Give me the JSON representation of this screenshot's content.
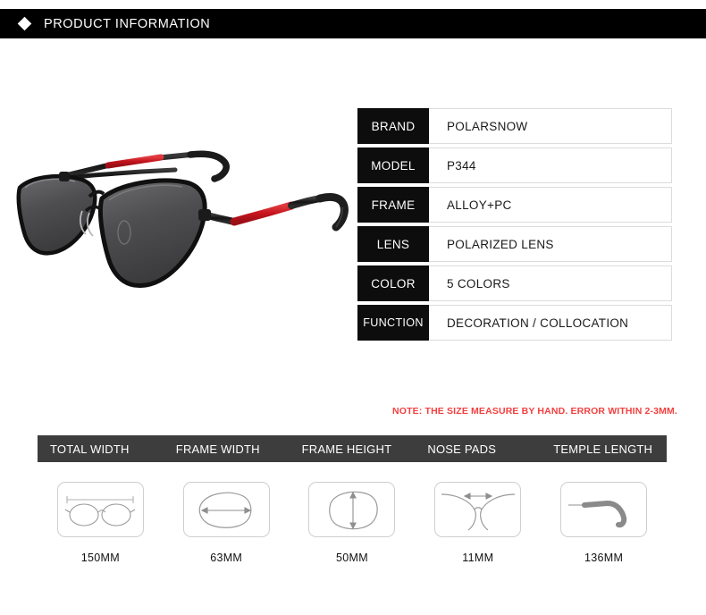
{
  "header": {
    "icon": "diamond-bullet-icon",
    "title": "PRODUCT INFORMATION"
  },
  "product_image": {
    "alt": "black aviator sunglasses with red temple accents",
    "frame_color": "#1a1a1a",
    "accent_color": "#cf2027",
    "lens_color": "#58585a"
  },
  "spec_table": {
    "rows": [
      {
        "label": "BRAND",
        "value": "POLARSNOW"
      },
      {
        "label": "MODEL",
        "value": "P344"
      },
      {
        "label": "FRAME",
        "value": "ALLOY+PC"
      },
      {
        "label": "LENS",
        "value": "POLARIZED LENS"
      },
      {
        "label": "COLOR",
        "value": "5 COLORS"
      },
      {
        "label": "FUNCTION",
        "value": "DECORATION / COLLOCATION"
      }
    ]
  },
  "note": {
    "text": "NOTE: THE SIZE MEASURE BY HAND. ERROR WITHIN 2-3MM.",
    "color": "#f43f3f"
  },
  "measurements": {
    "header_bg": "#3d3d3d",
    "columns": [
      {
        "header": "TOTAL WIDTH",
        "value": "150MM",
        "icon": "glasses-front-width-icon"
      },
      {
        "header": "FRAME WIDTH",
        "value": "63MM",
        "icon": "lens-width-icon"
      },
      {
        "header": "FRAME HEIGHT",
        "value": "50MM",
        "icon": "lens-height-icon"
      },
      {
        "header": "NOSE PADS",
        "value": "11MM",
        "icon": "nose-bridge-icon"
      },
      {
        "header": "TEMPLE LENGTH",
        "value": "136MM",
        "icon": "temple-arm-icon"
      }
    ]
  }
}
